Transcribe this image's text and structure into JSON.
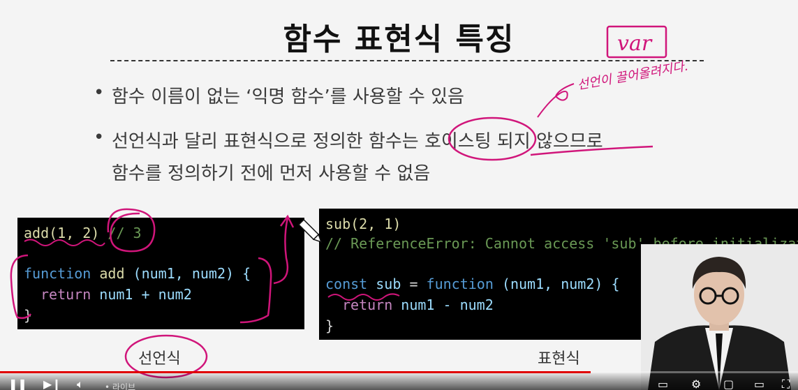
{
  "slide": {
    "title": "함수 표현식 특징",
    "bullets": [
      "함수 이름이 없는 ‘익명 함수’를 사용할 수 있음",
      "선언식과 달리 표현식으로 정의한 함수는 호이스팅 되지 않으므로",
      "함수를 정의하기 전에 먼저 사용할 수 없음"
    ],
    "bullet_marker": "•",
    "labels": {
      "declaration": "선언식",
      "expression": "표현식"
    }
  },
  "code_declaration": {
    "l1_call": "add(1, 2)",
    "l1_comment": "// 3",
    "l3_kw": "function",
    "l3_name": "add",
    "l3_params": "(num1, num2) {",
    "l4_kw": "return",
    "l4_expr": "num1 + num2",
    "l5": "}"
  },
  "code_expression": {
    "l1_call": "sub(2, 1)",
    "l2_comment": "// ReferenceError: Cannot access 'sub' before initialization",
    "l4_kw": "const",
    "l4_name": "sub",
    "l4_eq": "=",
    "l4_fn": "function",
    "l4_params": "(num1, num2) {",
    "l5_kw": "return",
    "l5_expr": "num1 - num2",
    "l6": "}"
  },
  "annotations": {
    "var_box": "var",
    "handwriting": "선언이 끌어올려지다."
  },
  "player": {
    "live_label": "라이브",
    "progress_fraction": 0.74,
    "accent_color": "#e00000"
  }
}
